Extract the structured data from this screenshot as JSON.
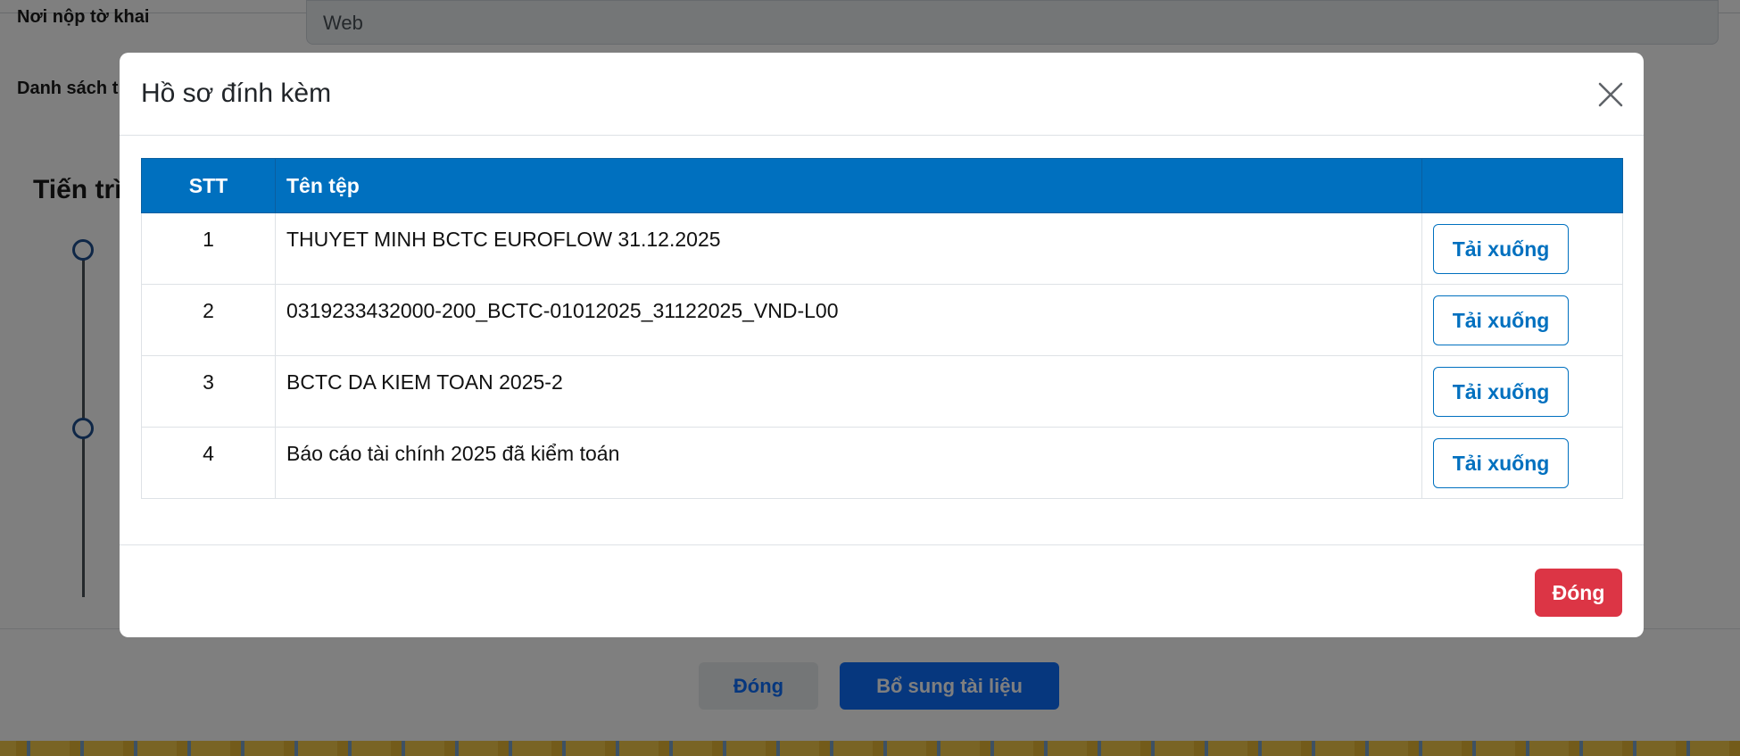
{
  "background": {
    "field_submit_place_label": "Nơi nộp tờ khai",
    "field_submit_place_value": "Web",
    "field_list_label": "Danh sách t",
    "progress_heading": "Tiến trì",
    "close_button": "Đóng",
    "add_docs_button": "Bổ sung tài liệu"
  },
  "modal": {
    "title": "Hồ sơ đính kèm",
    "table": {
      "headers": {
        "stt": "STT",
        "file_name": "Tên tệp",
        "action": ""
      },
      "rows": [
        {
          "stt": "1",
          "file_name": "THUYET MINH BCTC EUROFLOW 31.12.2025",
          "action": "Tải xuống"
        },
        {
          "stt": "2",
          "file_name": "0319233432000-200_BCTC-01012025_31122025_VND-L00",
          "action": "Tải xuống"
        },
        {
          "stt": "3",
          "file_name": "BCTC DA KIEM TOAN 2025-2",
          "action": "Tải xuống"
        },
        {
          "stt": "4",
          "file_name": "Báo cáo tài chính 2025 đã kiểm toán",
          "action": "Tải xuống"
        }
      ]
    },
    "close_button": "Đóng"
  },
  "colors": {
    "header_blue": "#0070bf",
    "danger_red": "#dc3545",
    "primary_blue": "#0d6efd"
  },
  "icons": {
    "modal_close": "close-icon",
    "timeline_step": "circle-icon"
  }
}
